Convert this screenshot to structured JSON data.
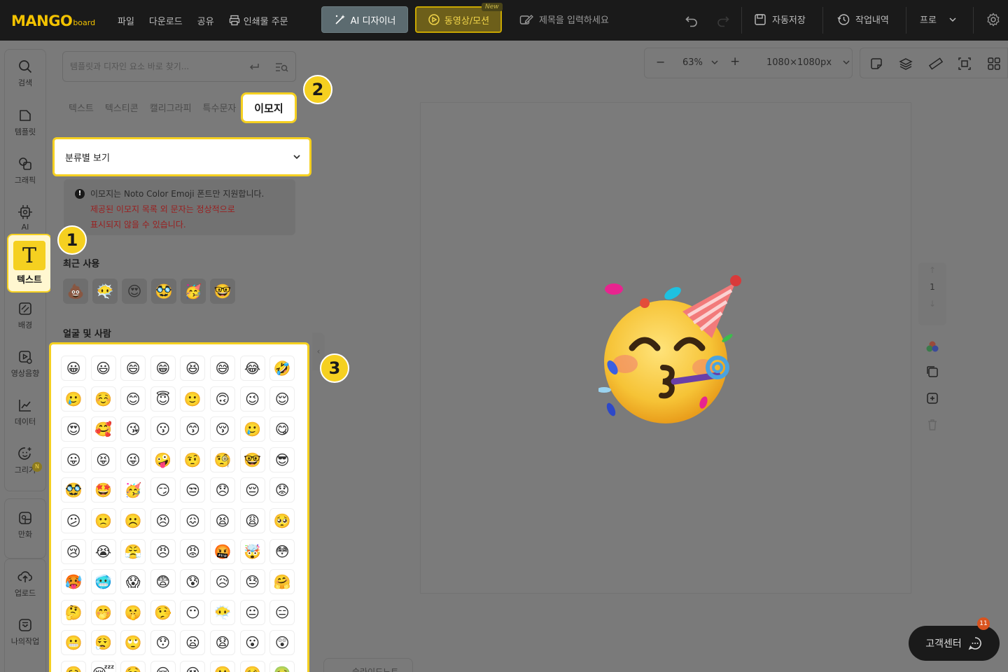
{
  "topbar": {
    "logo_main": "MANGO",
    "logo_sub": "board",
    "menu": [
      "파일",
      "다운로드",
      "공유",
      "인쇄물 주문"
    ],
    "ai_designer": "AI 디자이너",
    "video_motion": "동영상/모션",
    "new_badge": "New",
    "title_placeholder": "제목을 입력하세요",
    "autosave": "자동저장",
    "history": "작업내역",
    "pro": "프로"
  },
  "leftnav": {
    "items": [
      "검색",
      "템플릿",
      "그래픽",
      "AI",
      "텍스트",
      "배경",
      "영상음향",
      "데이터",
      "그리기",
      "만화",
      "업로드",
      "나의작업"
    ],
    "new_badge": "N"
  },
  "panel": {
    "search_placeholder": "템플릿과 디자인 요소 바로 찾기...",
    "tabs": [
      "텍스트",
      "텍스티콘",
      "캘리그라피",
      "특수문자",
      "이모지"
    ],
    "select_value": "분류별 보기",
    "notice_line1": "이모지는 Noto Color Emoji 폰트만 지원합니다.",
    "notice_line2": "제공된 이모지 목록 외 문자는 정상적으로",
    "notice_line3": "표시되지 않을 수 있습니다.",
    "notice_icon": "!",
    "recent_title": "최근 사용",
    "recent": [
      "💩",
      "😶‍🌫️",
      "😍",
      "🥸",
      "🥳",
      "🤓"
    ],
    "faces_title": "얼굴 및 사람",
    "faces": [
      "😀",
      "😃",
      "😄",
      "😁",
      "😆",
      "😅",
      "😂",
      "🤣",
      "🥲",
      "☺️",
      "😊",
      "😇",
      "🙂",
      "🙃",
      "😉",
      "😌",
      "😍",
      "🥰",
      "😘",
      "😗",
      "😙",
      "😚",
      "🥲",
      "😋",
      "😛",
      "😝",
      "😜",
      "🤪",
      "🤨",
      "🧐",
      "🤓",
      "😎",
      "🥸",
      "🤩",
      "🥳",
      "😏",
      "😒",
      "😞",
      "😔",
      "😟",
      "😕",
      "🙁",
      "☹️",
      "😣",
      "😖",
      "😫",
      "😩",
      "🥺",
      "😢",
      "😭",
      "😤",
      "😠",
      "😡",
      "🤬",
      "🤯",
      "😳",
      "🥵",
      "🥶",
      "😱",
      "😨",
      "😰",
      "😥",
      "😓",
      "🤗",
      "🤔",
      "🤭",
      "🤫",
      "🤥",
      "😶",
      "😶‍🌫️",
      "😐",
      "😑",
      "😬",
      "😮‍💨",
      "🙄",
      "😯",
      "😦",
      "😧",
      "😮",
      "😲",
      "🥱",
      "😴",
      "🤤",
      "😪",
      "😵",
      "🤐",
      "🥴",
      "🤢"
    ],
    "collapse": "‹"
  },
  "callouts": [
    "1",
    "2",
    "3"
  ],
  "toolbar": {
    "zoom_minus": "−",
    "zoom": "63%",
    "zoom_plus": "+",
    "size": "1080×1080px"
  },
  "page_nav": {
    "up": "↑",
    "page": "1",
    "down": "↓"
  },
  "customer_center": "고객센터",
  "cs_badge": "11",
  "slide_note": "슬라이드노트",
  "colors": {
    "accent": "#f5d020",
    "topbar": "#1a1a1a",
    "overlay": "#7a7a7a",
    "notice_red": "#9a1f1f"
  }
}
